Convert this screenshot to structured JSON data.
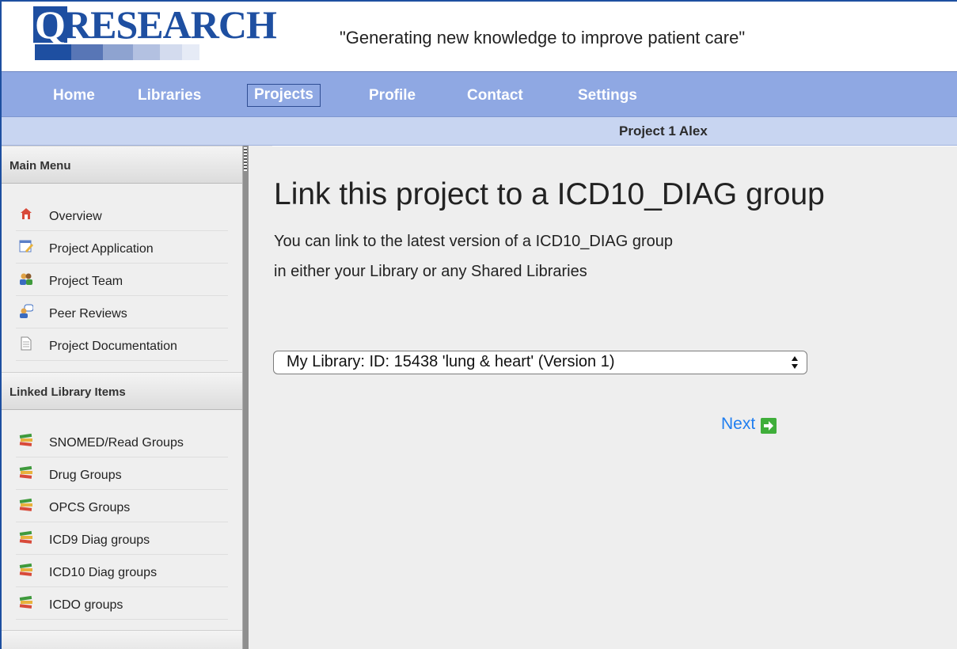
{
  "header": {
    "logo_letter": "Q",
    "logo_word": "RESEARCH",
    "tagline": "\"Generating new knowledge to improve patient care\""
  },
  "nav": {
    "items": [
      {
        "label": "Home"
      },
      {
        "label": "Libraries"
      },
      {
        "label": "Projects",
        "active": true
      },
      {
        "label": "Profile"
      },
      {
        "label": "Contact"
      },
      {
        "label": "Settings"
      }
    ]
  },
  "project": {
    "name": "Project 1 Alex"
  },
  "sidebar": {
    "main_menu": {
      "title": "Main Menu",
      "items": [
        {
          "label": "Overview",
          "icon": "home-icon"
        },
        {
          "label": "Project Application",
          "icon": "form-edit-icon"
        },
        {
          "label": "Project Team",
          "icon": "team-icon"
        },
        {
          "label": "Peer Reviews",
          "icon": "peer-review-icon"
        },
        {
          "label": "Project Documentation",
          "icon": "document-icon"
        }
      ]
    },
    "linked": {
      "title": "Linked Library Items",
      "items": [
        {
          "label": "SNOMED/Read Groups",
          "icon": "books-icon"
        },
        {
          "label": "Drug Groups",
          "icon": "books-icon"
        },
        {
          "label": "OPCS Groups",
          "icon": "books-icon"
        },
        {
          "label": "ICD9 Diag groups",
          "icon": "books-icon"
        },
        {
          "label": "ICD10 Diag groups",
          "icon": "books-icon"
        },
        {
          "label": "ICDO groups",
          "icon": "books-icon"
        }
      ]
    }
  },
  "main": {
    "title": "Link this project to a ICD10_DIAG group",
    "description_line1": "You can link to the latest version of a ICD10_DIAG group",
    "description_line2": "in either your Library or any Shared Libraries",
    "select": {
      "selected": "My Library: ID: 15438 'lung & heart' (Version 1)"
    },
    "next_label": "Next",
    "next_icon": "arrow-right-icon"
  },
  "colors": {
    "brand_blue": "#1e4fa1",
    "nav_bg": "#8fa8e3",
    "project_bar_bg": "#c8d5f1",
    "link_blue": "#1f7ef0",
    "next_icon_green": "#3fae3a"
  }
}
